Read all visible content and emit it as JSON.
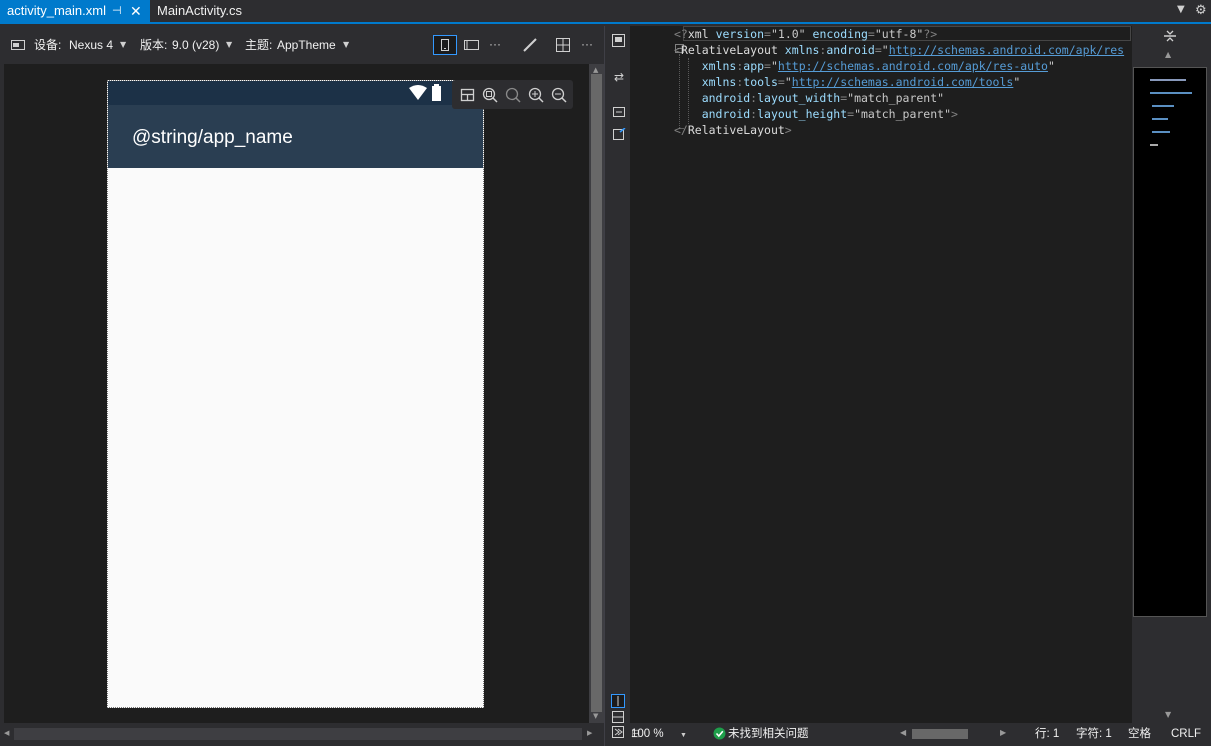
{
  "tabs": [
    {
      "label": "activity_main.xml",
      "active": true,
      "pin_glyph": "⊣",
      "close_glyph": "✕"
    },
    {
      "label": "MainActivity.cs",
      "active": false
    }
  ],
  "tab_controls": {
    "dropdown": "▼",
    "settings": "⚙"
  },
  "designer_toolbar": {
    "device_label": "设备:",
    "device_value": "Nexus 4",
    "version_label": "版本:",
    "version_value": "9.0 (v28)",
    "theme_label": "主题:",
    "theme_value": "AppTheme",
    "more": "···"
  },
  "device_preview": {
    "app_title": "@string/app_name",
    "status_icons": [
      "wifi-icon",
      "battery-icon"
    ],
    "colors": {
      "status_bar": "#1c3147",
      "app_bar": "#2a3e52",
      "content": "#fafafa"
    }
  },
  "zoom_tools": [
    "layout-icon",
    "zoom-fit-icon",
    "zoom-actual-icon",
    "zoom-in-icon",
    "zoom-out-icon"
  ],
  "code": {
    "lines": [
      [
        [
          "delim",
          "<?"
        ],
        [
          "tag",
          "xml "
        ],
        [
          "attr",
          "version"
        ],
        [
          "delim",
          "="
        ],
        [
          "val",
          "\"1.0\""
        ],
        [
          "plain",
          " "
        ],
        [
          "attr",
          "encoding"
        ],
        [
          "delim",
          "="
        ],
        [
          "val",
          "\"utf-8\""
        ],
        [
          "delim",
          "?>"
        ]
      ],
      [
        [
          "delim",
          "<"
        ],
        [
          "tag",
          "RelativeLayout "
        ],
        [
          "attr",
          "xmlns"
        ],
        [
          "delim",
          ":"
        ],
        [
          "attr",
          "android"
        ],
        [
          "delim",
          "="
        ],
        [
          "val",
          "\""
        ],
        [
          "link",
          "http://schemas.android.com/apk/res"
        ]
      ],
      [
        [
          "plain",
          "    "
        ],
        [
          "attr",
          "xmlns"
        ],
        [
          "delim",
          ":"
        ],
        [
          "attr",
          "app"
        ],
        [
          "delim",
          "="
        ],
        [
          "val",
          "\""
        ],
        [
          "link",
          "http://schemas.android.com/apk/res-auto"
        ],
        [
          "val",
          "\""
        ]
      ],
      [
        [
          "plain",
          "    "
        ],
        [
          "attr",
          "xmlns"
        ],
        [
          "delim",
          ":"
        ],
        [
          "attr",
          "tools"
        ],
        [
          "delim",
          "="
        ],
        [
          "val",
          "\""
        ],
        [
          "link",
          "http://schemas.android.com/tools"
        ],
        [
          "val",
          "\""
        ]
      ],
      [
        [
          "plain",
          "    "
        ],
        [
          "attr",
          "android"
        ],
        [
          "delim",
          ":"
        ],
        [
          "attr",
          "layout_width"
        ],
        [
          "delim",
          "="
        ],
        [
          "val",
          "\"match_parent\""
        ]
      ],
      [
        [
          "plain",
          "    "
        ],
        [
          "attr",
          "android"
        ],
        [
          "delim",
          ":"
        ],
        [
          "attr",
          "layout_height"
        ],
        [
          "delim",
          "="
        ],
        [
          "val",
          "\"match_parent\""
        ],
        [
          "delim",
          ">"
        ]
      ],
      [
        [
          "delim",
          "</"
        ],
        [
          "tag",
          "RelativeLayout"
        ],
        [
          "delim",
          ">"
        ]
      ]
    ],
    "fold_glyph": "−"
  },
  "status_bar": {
    "zoom": "100 %",
    "issues": "未找到相关问题",
    "line": "行: 1",
    "char": "字符: 1",
    "spaces": "空格",
    "eol": "CRLF"
  },
  "colors": {
    "accent": "#007acc",
    "editor_bg": "#1e1e1e",
    "chrome_bg": "#2d2d30"
  }
}
